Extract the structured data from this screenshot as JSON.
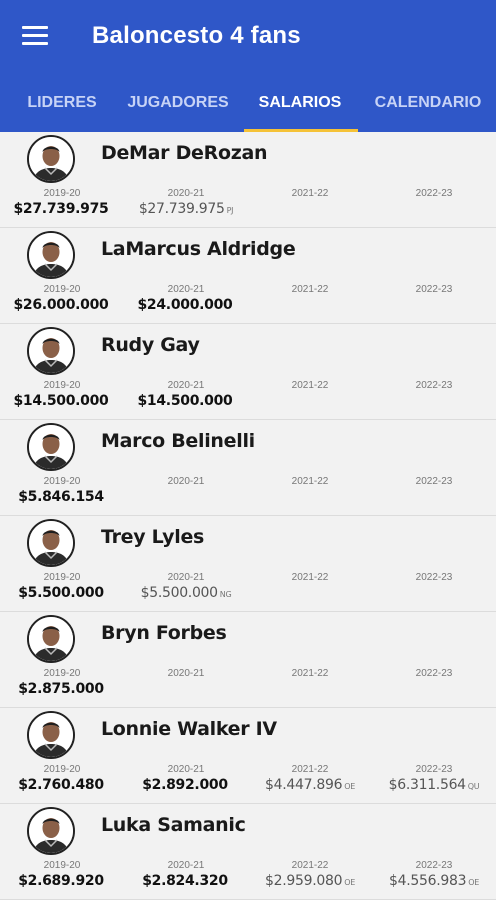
{
  "app": {
    "title": "Baloncesto 4 fans"
  },
  "tabs": [
    {
      "label": "LIDERES",
      "active": false
    },
    {
      "label": "JUGADORES",
      "active": false
    },
    {
      "label": "SALARIOS",
      "active": true
    },
    {
      "label": "CALENDARIO",
      "active": false
    }
  ],
  "colors": {
    "appbar": "#2f57c8",
    "indicator": "#f5c237",
    "background": "#f2f2f2"
  },
  "players": [
    {
      "name": "DeMar DeRozan",
      "salaries": [
        {
          "season": "2019-20",
          "amount": "$27.739.975",
          "flag": ""
        },
        {
          "season": "2020-21",
          "amount": "$27.739.975",
          "flag": "PJ"
        },
        {
          "season": "2021-22",
          "amount": "",
          "flag": ""
        },
        {
          "season": "2022-23",
          "amount": "",
          "flag": ""
        }
      ]
    },
    {
      "name": "LaMarcus Aldridge",
      "salaries": [
        {
          "season": "2019-20",
          "amount": "$26.000.000",
          "flag": ""
        },
        {
          "season": "2020-21",
          "amount": "$24.000.000",
          "flag": ""
        },
        {
          "season": "2021-22",
          "amount": "",
          "flag": ""
        },
        {
          "season": "2022-23",
          "amount": "",
          "flag": ""
        }
      ]
    },
    {
      "name": "Rudy Gay",
      "salaries": [
        {
          "season": "2019-20",
          "amount": "$14.500.000",
          "flag": ""
        },
        {
          "season": "2020-21",
          "amount": "$14.500.000",
          "flag": ""
        },
        {
          "season": "2021-22",
          "amount": "",
          "flag": ""
        },
        {
          "season": "2022-23",
          "amount": "",
          "flag": ""
        }
      ]
    },
    {
      "name": "Marco Belinelli",
      "salaries": [
        {
          "season": "2019-20",
          "amount": "$5.846.154",
          "flag": ""
        },
        {
          "season": "2020-21",
          "amount": "",
          "flag": ""
        },
        {
          "season": "2021-22",
          "amount": "",
          "flag": ""
        },
        {
          "season": "2022-23",
          "amount": "",
          "flag": ""
        }
      ]
    },
    {
      "name": "Trey Lyles",
      "salaries": [
        {
          "season": "2019-20",
          "amount": "$5.500.000",
          "flag": ""
        },
        {
          "season": "2020-21",
          "amount": "$5.500.000",
          "flag": "NG"
        },
        {
          "season": "2021-22",
          "amount": "",
          "flag": ""
        },
        {
          "season": "2022-23",
          "amount": "",
          "flag": ""
        }
      ]
    },
    {
      "name": "Bryn Forbes",
      "salaries": [
        {
          "season": "2019-20",
          "amount": "$2.875.000",
          "flag": ""
        },
        {
          "season": "2020-21",
          "amount": "",
          "flag": ""
        },
        {
          "season": "2021-22",
          "amount": "",
          "flag": ""
        },
        {
          "season": "2022-23",
          "amount": "",
          "flag": ""
        }
      ]
    },
    {
      "name": "Lonnie Walker IV",
      "salaries": [
        {
          "season": "2019-20",
          "amount": "$2.760.480",
          "flag": ""
        },
        {
          "season": "2020-21",
          "amount": "$2.892.000",
          "flag": ""
        },
        {
          "season": "2021-22",
          "amount": "$4.447.896",
          "flag": "OE"
        },
        {
          "season": "2022-23",
          "amount": "$6.311.564",
          "flag": "QU"
        }
      ]
    },
    {
      "name": "Luka Samanic",
      "salaries": [
        {
          "season": "2019-20",
          "amount": "$2.689.920",
          "flag": ""
        },
        {
          "season": "2020-21",
          "amount": "$2.824.320",
          "flag": ""
        },
        {
          "season": "2021-22",
          "amount": "$2.959.080",
          "flag": "OE"
        },
        {
          "season": "2022-23",
          "amount": "$4.556.983",
          "flag": "OE"
        }
      ]
    }
  ]
}
